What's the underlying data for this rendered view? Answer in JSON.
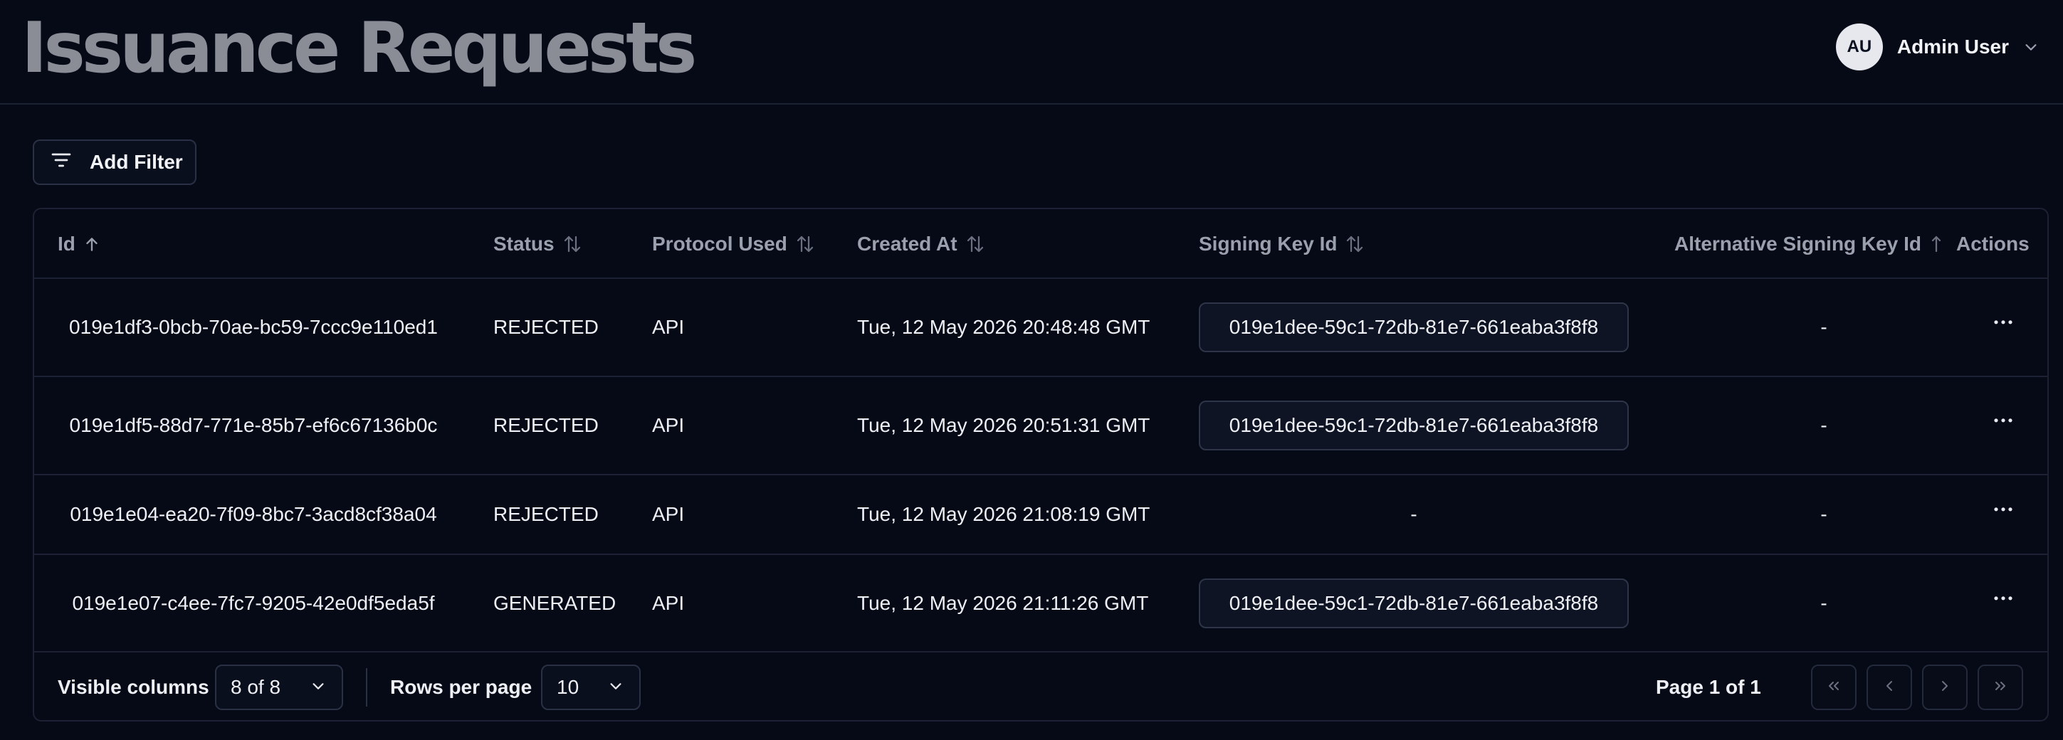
{
  "header": {
    "title": "Issuance Requests",
    "user": {
      "initials": "AU",
      "name": "Admin User"
    }
  },
  "toolbar": {
    "add_filter_label": "Add Filter"
  },
  "table": {
    "columns": [
      {
        "key": "id",
        "label": "Id",
        "sort": "asc"
      },
      {
        "key": "status",
        "label": "Status",
        "sort": "none"
      },
      {
        "key": "protocol",
        "label": "Protocol Used",
        "sort": "none"
      },
      {
        "key": "created_at",
        "label": "Created At",
        "sort": "none"
      },
      {
        "key": "signing_key_id",
        "label": "Signing Key Id",
        "sort": "none"
      },
      {
        "key": "alt_signing_key_id",
        "label": "Alternative Signing Key Id",
        "sort": "none"
      },
      {
        "key": "actions",
        "label": "Actions",
        "sort": null
      }
    ],
    "rows": [
      {
        "id": "019e1df3-0bcb-70ae-bc59-7ccc9e110ed1",
        "status": "REJECTED",
        "protocol": "API",
        "created_at": "Tue, 12 May 2026 20:48:48 GMT",
        "signing_key_id": "019e1dee-59c1-72db-81e7-661eaba3f8f8",
        "alt_signing_key_id": "-"
      },
      {
        "id": "019e1df5-88d7-771e-85b7-ef6c67136b0c",
        "status": "REJECTED",
        "protocol": "API",
        "created_at": "Tue, 12 May 2026 20:51:31 GMT",
        "signing_key_id": "019e1dee-59c1-72db-81e7-661eaba3f8f8",
        "alt_signing_key_id": "-"
      },
      {
        "id": "019e1e04-ea20-7f09-8bc7-3acd8cf38a04",
        "status": "REJECTED",
        "protocol": "API",
        "created_at": "Tue, 12 May 2026 21:08:19 GMT",
        "signing_key_id": "-",
        "alt_signing_key_id": "-"
      },
      {
        "id": "019e1e07-c4ee-7fc7-9205-42e0df5eda5f",
        "status": "GENERATED",
        "protocol": "API",
        "created_at": "Tue, 12 May 2026 21:11:26 GMT",
        "signing_key_id": "019e1dee-59c1-72db-81e7-661eaba3f8f8",
        "alt_signing_key_id": "-"
      }
    ]
  },
  "footer": {
    "visible_columns_label": "Visible columns",
    "visible_columns_value": "8 of 8",
    "rows_per_page_label": "Rows per page",
    "rows_per_page_value": "10",
    "page_info": "Page 1 of 1"
  },
  "icons": {
    "filter": "filter-lines-icon",
    "sort": "sort-arrows-icon",
    "sort_asc": "arrow-up-icon",
    "actions": "more-horizontal-icon",
    "chevron": "chevron-down-icon",
    "first": "chevrons-left-icon",
    "prev": "chevron-left-icon",
    "next": "chevron-right-icon",
    "last": "chevrons-right-icon"
  }
}
